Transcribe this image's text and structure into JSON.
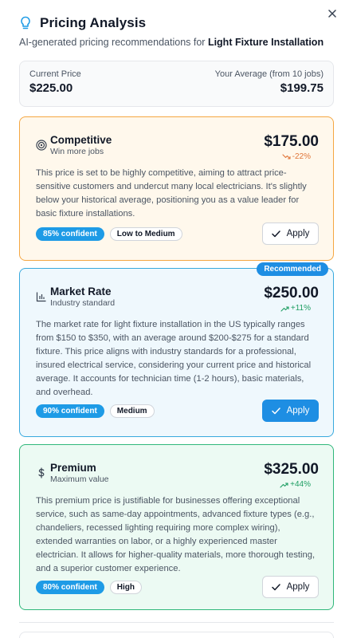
{
  "header": {
    "title": "Pricing Analysis",
    "icon": "lightbulb-icon",
    "subtitle_prefix": "AI-generated pricing recommendations for ",
    "subtitle_service": "Light Fixture Installation"
  },
  "summary": {
    "current_label": "Current Price",
    "current_value": "$225.00",
    "average_label": "Your Average (from 10 jobs)",
    "average_value": "$199.75"
  },
  "cards": [
    {
      "name": "Competitive",
      "tagline": "Win more jobs",
      "icon": "target-icon",
      "price": "$175.00",
      "delta": "-22%",
      "delta_direction": "down",
      "description": "This price is set to be highly competitive, aiming to attract price-sensitive customers and undercut many local electricians. It's slightly below your historical average, positioning you as a value leader for basic fixture installations.",
      "confidence": "85% confident",
      "level": "Low to Medium",
      "apply_label": "Apply"
    },
    {
      "name": "Market Rate",
      "tagline": "Industry standard",
      "icon": "bar-chart-icon",
      "badge": "Recommended",
      "price": "$250.00",
      "delta": "+11%",
      "delta_direction": "up",
      "description": "The market rate for light fixture installation in the US typically ranges from $150 to $350, with an average around $200-$275 for a standard fixture. This price aligns with industry standards for a professional, insured electrical service, considering your current price and historical average. It accounts for technician time (1-2 hours), basic materials, and overhead.",
      "confidence": "90% confident",
      "level": "Medium",
      "apply_label": "Apply"
    },
    {
      "name": "Premium",
      "tagline": "Maximum value",
      "icon": "dollar-icon",
      "price": "$325.00",
      "delta": "+44%",
      "delta_direction": "up",
      "description": "This premium price is justifiable for businesses offering exceptional service, such as same-day appointments, advanced fixture types (e.g., chandeliers, recessed lighting requiring more complex wiring), extended warranties on labor, or a highly experienced master electrician. It allows for higher-quality materials, more thorough testing, and a superior customer experience.",
      "confidence": "80% confident",
      "level": "High",
      "apply_label": "Apply"
    }
  ],
  "colors": {
    "competitive_border": "#f5a742",
    "market_border": "#38a9de",
    "premium_border": "#2fb77a",
    "accent": "#1e8ee3"
  }
}
